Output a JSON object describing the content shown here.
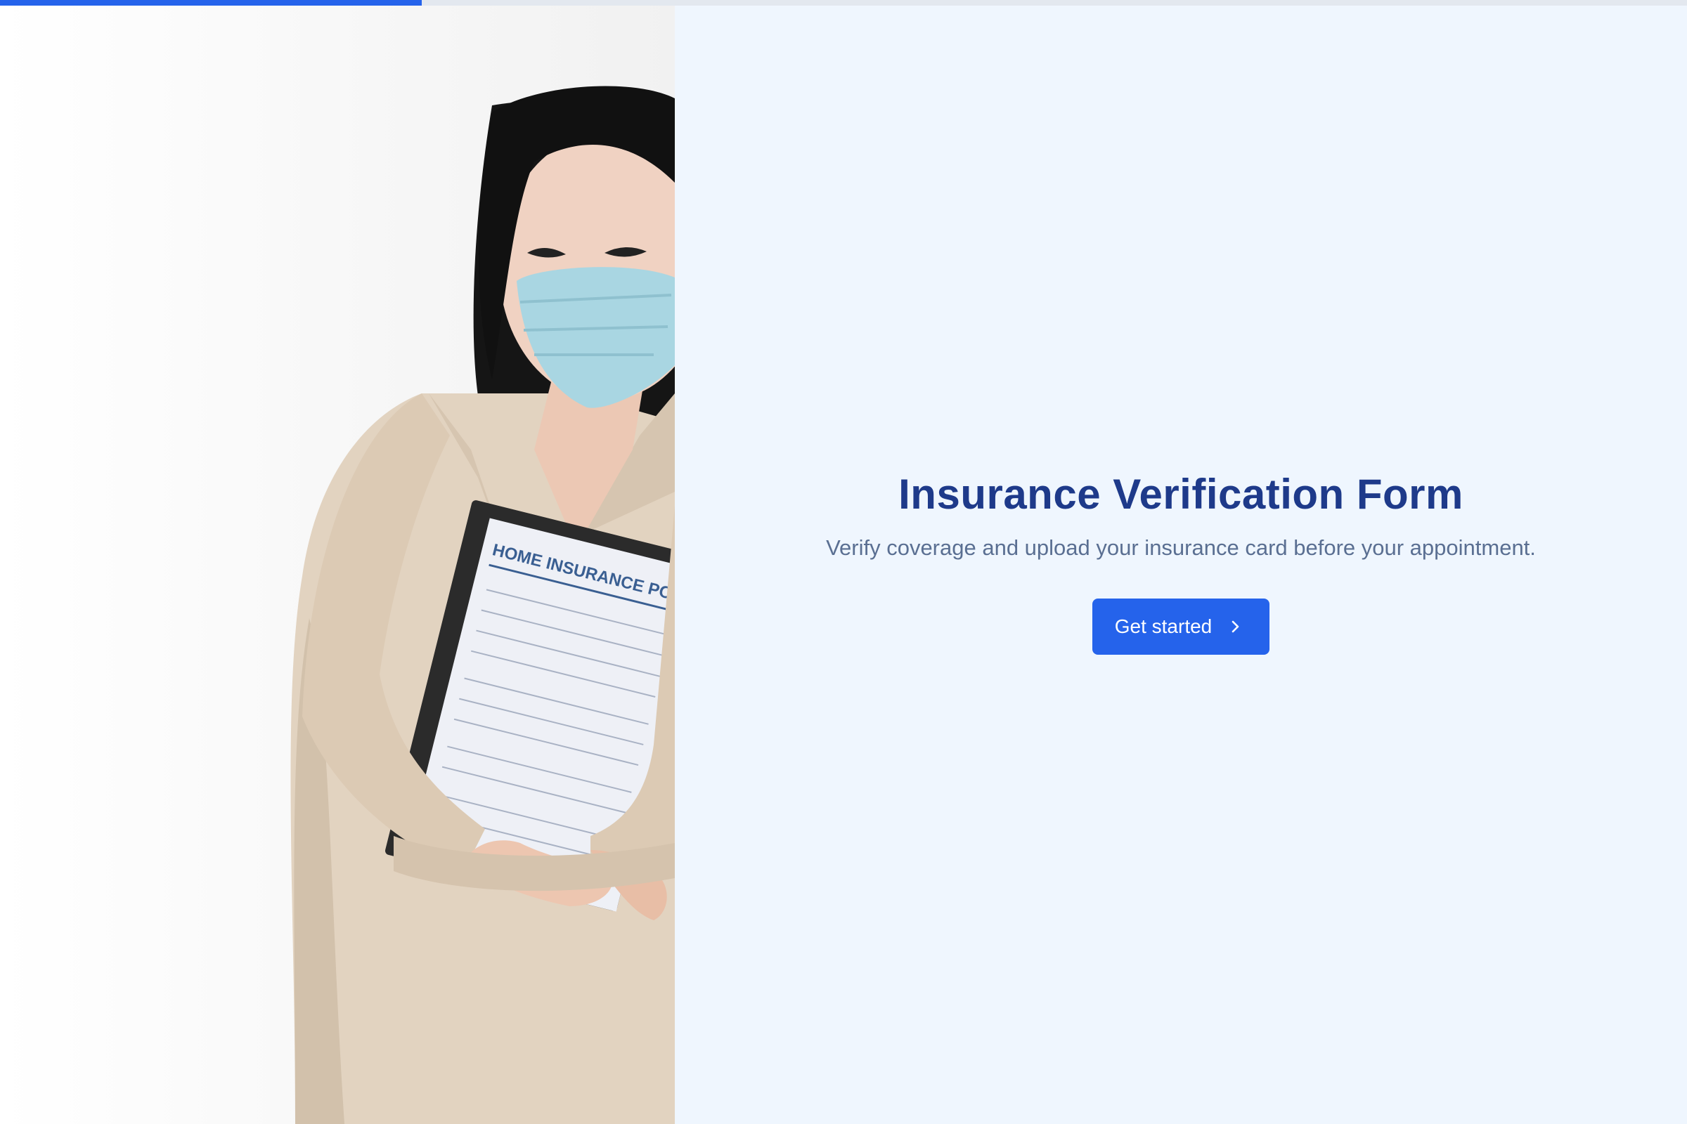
{
  "progress": {
    "percent": 25
  },
  "hero": {
    "image_alt": "Woman in a face mask holding a folder",
    "document_heading": "HOME INSURANCE POLICY"
  },
  "main": {
    "title": "Insurance Verification Form",
    "subtitle": "Verify coverage and upload your insurance card before your appointment.",
    "cta_label": "Get started",
    "cta_icon": "chevron-right-icon"
  },
  "colors": {
    "accent": "#2563eb",
    "title": "#1e3a8a",
    "subtitle": "#5a6f92",
    "panel_bg": "#eff6fe"
  }
}
